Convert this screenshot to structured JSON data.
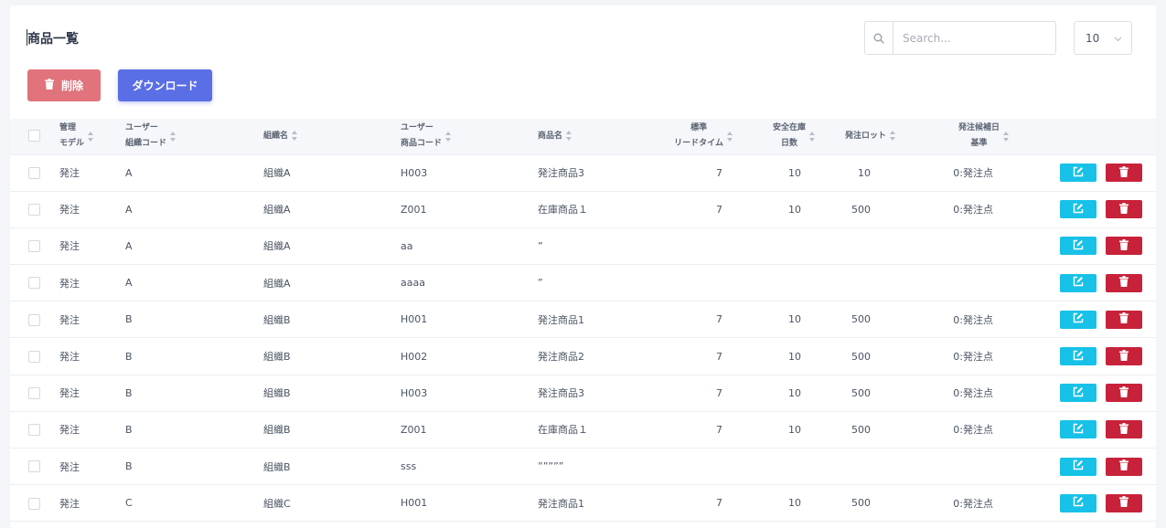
{
  "page": {
    "title": "商品一覧"
  },
  "search": {
    "placeholder": "Search...",
    "value": ""
  },
  "pagesize": {
    "value": "10"
  },
  "toolbar": {
    "delete_label": "削除",
    "download_label": "ダウンロード"
  },
  "icons": {
    "search": "search-icon",
    "trash": "trash-icon",
    "edit": "edit-icon",
    "chevron": "chevron-down-icon"
  },
  "colors": {
    "delete_btn": "#e0737b",
    "download_btn": "#5a6ee6",
    "edit_action": "#17c1e8",
    "delete_action": "#c8223a"
  },
  "table": {
    "headers": {
      "model": [
        "管理",
        "モデル"
      ],
      "org_code": [
        "ユーザー",
        "組織コード"
      ],
      "org_name": "組織名",
      "product_code": [
        "ユーザー",
        "商品コード"
      ],
      "product_name": "商品名",
      "lead_time": [
        "標準",
        "リードタイム"
      ],
      "safety_days": [
        "安全在庫",
        "日数"
      ],
      "lot": "発注ロット",
      "basis": [
        "発注候補日",
        "基準"
      ]
    },
    "rows": [
      {
        "model": "発注",
        "org_code": "A",
        "org_name": "組織A",
        "product_code": "H003",
        "product_name": "発注商品3",
        "lead_time": "7",
        "safety_days": "10",
        "lot": "10",
        "basis": "0:発注点"
      },
      {
        "model": "発注",
        "org_code": "A",
        "org_name": "組織A",
        "product_code": "Z001",
        "product_name": "在庫商品１",
        "lead_time": "7",
        "safety_days": "10",
        "lot": "500",
        "basis": "0:発注点"
      },
      {
        "model": "発注",
        "org_code": "A",
        "org_name": "組織A",
        "product_code": "aa",
        "product_name": "”",
        "lead_time": "",
        "safety_days": "",
        "lot": "",
        "basis": ""
      },
      {
        "model": "発注",
        "org_code": "A",
        "org_name": "組織A",
        "product_code": "aaaa",
        "product_name": "”",
        "lead_time": "",
        "safety_days": "",
        "lot": "",
        "basis": ""
      },
      {
        "model": "発注",
        "org_code": "B",
        "org_name": "組織B",
        "product_code": "H001",
        "product_name": "発注商品1",
        "lead_time": "7",
        "safety_days": "10",
        "lot": "500",
        "basis": "0:発注点"
      },
      {
        "model": "発注",
        "org_code": "B",
        "org_name": "組織B",
        "product_code": "H002",
        "product_name": "発注商品2",
        "lead_time": "7",
        "safety_days": "10",
        "lot": "500",
        "basis": "0:発注点"
      },
      {
        "model": "発注",
        "org_code": "B",
        "org_name": "組織B",
        "product_code": "H003",
        "product_name": "発注商品3",
        "lead_time": "7",
        "safety_days": "10",
        "lot": "500",
        "basis": "0:発注点"
      },
      {
        "model": "発注",
        "org_code": "B",
        "org_name": "組織B",
        "product_code": "Z001",
        "product_name": "在庫商品１",
        "lead_time": "7",
        "safety_days": "10",
        "lot": "500",
        "basis": "0:発注点"
      },
      {
        "model": "発注",
        "org_code": "B",
        "org_name": "組織B",
        "product_code": "sss",
        "product_name": "”””””",
        "lead_time": "",
        "safety_days": "",
        "lot": "",
        "basis": ""
      },
      {
        "model": "発注",
        "org_code": "C",
        "org_name": "組織C",
        "product_code": "H001",
        "product_name": "発注商品1",
        "lead_time": "7",
        "safety_days": "10",
        "lot": "500",
        "basis": "0:発注点"
      }
    ]
  }
}
